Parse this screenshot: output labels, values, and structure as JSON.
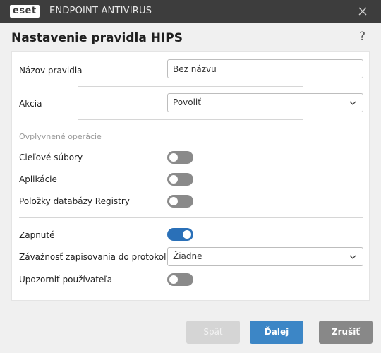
{
  "window": {
    "logo_text": "eset",
    "app_name": "ENDPOINT ANTIVIRUS"
  },
  "dialog": {
    "title": "Nastavenie pravidla HIPS",
    "help_glyph": "?"
  },
  "form": {
    "rule_name_label": "Názov pravidla",
    "rule_name_value": "Bez názvu",
    "action_label": "Akcia",
    "action_value": "Povoliť",
    "affected_ops_title": "Ovplyvnené operácie",
    "target_files_label": "Cieľové súbory",
    "target_files_on": false,
    "applications_label": "Aplikácie",
    "applications_on": false,
    "registry_label": "Položky databázy Registry",
    "registry_on": false,
    "enabled_label": "Zapnuté",
    "enabled_on": true,
    "log_severity_label": "Závažnosť zapisovania do protokolu",
    "log_severity_value": "Žiadne",
    "notify_user_label": "Upozorniť používateľa",
    "notify_user_on": false
  },
  "buttons": {
    "back": "Späť",
    "next": "Ďalej",
    "cancel": "Zrušiť"
  },
  "colors": {
    "titlebar": "#3d3d3d",
    "accent": "#2a70b8",
    "toggle_off": "#8a8a8a",
    "primary_button": "#3c86c6"
  }
}
